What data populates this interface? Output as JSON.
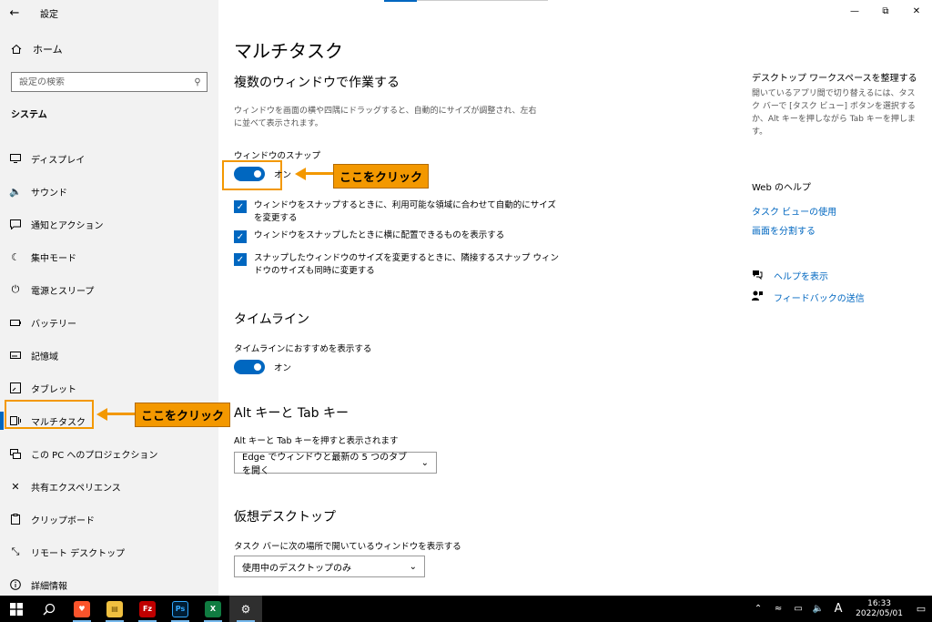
{
  "app": {
    "title": "設定"
  },
  "sidebar": {
    "home_label": "ホーム",
    "search_placeholder": "設定の検索",
    "section_title": "システム",
    "items": [
      {
        "label": "ディスプレイ",
        "icon": "monitor-icon"
      },
      {
        "label": "サウンド",
        "icon": "speaker-icon"
      },
      {
        "label": "通知とアクション",
        "icon": "notification-icon"
      },
      {
        "label": "集中モード",
        "icon": "moon-icon"
      },
      {
        "label": "電源とスリープ",
        "icon": "power-icon"
      },
      {
        "label": "バッテリー",
        "icon": "battery-icon"
      },
      {
        "label": "記憶域",
        "icon": "storage-icon"
      },
      {
        "label": "タブレット",
        "icon": "tablet-icon"
      },
      {
        "label": "マルチタスク",
        "icon": "multitask-icon",
        "active": true
      },
      {
        "label": "この PC へのプロジェクション",
        "icon": "projection-icon"
      },
      {
        "label": "共有エクスペリエンス",
        "icon": "share-icon"
      },
      {
        "label": "クリップボード",
        "icon": "clipboard-icon"
      },
      {
        "label": "リモート デスクトップ",
        "icon": "remote-icon"
      },
      {
        "label": "詳細情報",
        "icon": "info-icon"
      }
    ]
  },
  "main": {
    "page_title": "マルチタスク",
    "snap": {
      "heading": "複数のウィンドウで作業する",
      "description": "ウィンドウを画面の横や四隅にドラッグすると、自動的にサイズが調整され、左右に並べて表示されます。",
      "toggle_label": "ウィンドウのスナップ",
      "toggle_state": "オン",
      "checks": [
        "ウィンドウをスナップするときに、利用可能な領域に合わせて自動的にサイズを変更する",
        "ウィンドウをスナップしたときに横に配置できるものを表示する",
        "スナップしたウィンドウのサイズを変更するときに、隣接するスナップ ウィンドウのサイズも同時に変更する"
      ]
    },
    "timeline": {
      "heading": "タイムライン",
      "toggle_label": "タイムラインにおすすめを表示する",
      "toggle_state": "オン"
    },
    "alttab": {
      "heading": "Alt キーと Tab キー",
      "label": "Alt キーと Tab キーを押すと表示されます",
      "selected": "Edge でウィンドウと最新の 5 つのタブを開く"
    },
    "virtual": {
      "heading": "仮想デスクトップ",
      "label": "タスク バーに次の場所で開いているウィンドウを表示する",
      "selected": "使用中のデスクトップのみ"
    }
  },
  "right": {
    "workspace_heading": "デスクトップ ワークスペースを整理する",
    "workspace_text": "開いているアプリ間で切り替えるには、タスク バーで [タスク ビュー] ボタンを選択するか、Alt キーを押しながら Tab キーを押します。",
    "web_help": "Web のヘルプ",
    "links": [
      "タスク ビューの使用",
      "画面を分割する"
    ],
    "help": "ヘルプを表示",
    "feedback": "フィードバックの送信"
  },
  "annotations": {
    "callout_top": "ここをクリック",
    "callout_side": "ここをクリック",
    "color": "#f39800"
  },
  "taskbar": {
    "time": "16:33",
    "date": "2022/05/01",
    "ime": "A",
    "accent": "#0067c0"
  }
}
